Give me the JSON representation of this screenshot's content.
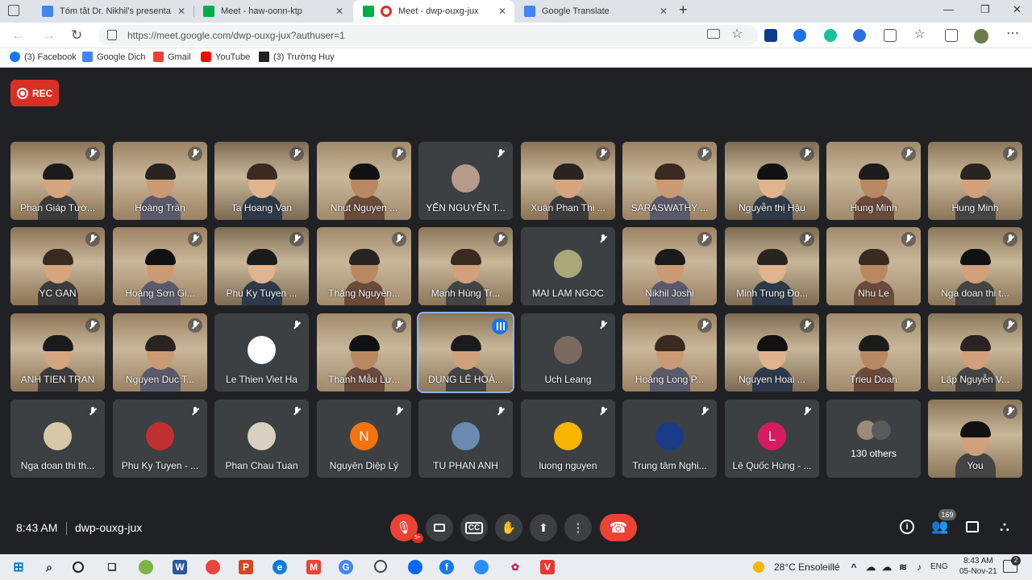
{
  "browser": {
    "tabs": [
      {
        "label": "Tóm tắt Dr. Nikhil's presentation",
        "icon": "google-docs-icon",
        "color": "#4285f4",
        "active": false
      },
      {
        "label": "Meet - haw-oonn-ktp",
        "icon": "google-meet-icon",
        "color": "#00ac47",
        "active": false
      },
      {
        "label": "Meet - dwp-ouxg-jux",
        "icon": "google-meet-icon",
        "color": "#00ac47",
        "active": true
      },
      {
        "label": "Google Translate",
        "icon": "google-translate-icon",
        "color": "#4285f4",
        "active": false
      }
    ],
    "url": "https://meet.google.com/dwp-ouxg-jux?authuser=1",
    "bookmarks": [
      {
        "label": "(3) Facebook",
        "icon": "facebook-icon",
        "color": "#1877f2"
      },
      {
        "label": "Google Dịch",
        "icon": "google-translate-icon",
        "color": "#4285f4"
      },
      {
        "label": "Gmail",
        "icon": "gmail-icon",
        "color": "#ea4335"
      },
      {
        "label": "YouTube",
        "icon": "youtube-icon",
        "color": "#ff0000"
      },
      {
        "label": "(3) Trường Huy",
        "icon": "graduation-cap-icon",
        "color": "#222222"
      }
    ]
  },
  "meet": {
    "rec_label": "REC",
    "time": "8:43 AM",
    "code": "dwp-ouxg-jux",
    "participant_count": "169",
    "reactions_badge": "5+",
    "participants": [
      {
        "name": "Phan Giáp Tườ...",
        "kind": "cam",
        "muted": true
      },
      {
        "name": "Hoàng Trần",
        "kind": "cam",
        "muted": true
      },
      {
        "name": "Ta Hoang Van",
        "kind": "cam",
        "muted": true
      },
      {
        "name": "Nhut Nguyen ...",
        "kind": "cam",
        "muted": true
      },
      {
        "name": "YẾN NGUYỄN T...",
        "kind": "avatar",
        "avatar_color": "#b89a8a",
        "muted": true
      },
      {
        "name": "Xuân Phan Thị ...",
        "kind": "cam",
        "muted": true
      },
      {
        "name": "SARASWATHY ...",
        "kind": "cam",
        "muted": true
      },
      {
        "name": "Nguyễn thị Hậu",
        "kind": "cam",
        "muted": true
      },
      {
        "name": "Hung Minh",
        "kind": "cam",
        "muted": true
      },
      {
        "name": "Hung Minh",
        "kind": "cam",
        "muted": true
      },
      {
        "name": "YC GAN",
        "kind": "cam",
        "muted": true
      },
      {
        "name": "Hoàng Sơn Gi...",
        "kind": "cam",
        "muted": true
      },
      {
        "name": "Phu Ky Tuyen ...",
        "kind": "cam",
        "muted": true
      },
      {
        "name": "Thắng Nguyễn...",
        "kind": "cam",
        "muted": true
      },
      {
        "name": "Mạnh Hùng Tr...",
        "kind": "cam",
        "muted": true
      },
      {
        "name": "MAI LAM NGOC",
        "kind": "avatar",
        "avatar_color": "#a8a878",
        "muted": true
      },
      {
        "name": "Nikhil Joshi",
        "kind": "cam",
        "muted": true
      },
      {
        "name": "Minh Trung Đo...",
        "kind": "cam",
        "muted": true
      },
      {
        "name": "Nhu Le",
        "kind": "cam",
        "muted": true
      },
      {
        "name": "Nga doan thi t...",
        "kind": "cam",
        "muted": true
      },
      {
        "name": "ANH TIEN TRAN",
        "kind": "cam",
        "muted": true
      },
      {
        "name": "Nguyen Duc T...",
        "kind": "cam",
        "muted": true
      },
      {
        "name": "Le Thien Viet Ha",
        "kind": "avatar",
        "avatar_color": "#ffffff",
        "muted": true
      },
      {
        "name": "Thanh Mẫu Lư...",
        "kind": "cam",
        "muted": true
      },
      {
        "name": "DUNG LÊ HOÀ...",
        "kind": "cam",
        "muted": false,
        "speaking": true
      },
      {
        "name": "Uch Leang",
        "kind": "avatar",
        "avatar_color": "#7a6a60",
        "muted": true
      },
      {
        "name": "Hoàng Long P...",
        "kind": "cam",
        "muted": true
      },
      {
        "name": "Nguyen Hoai ...",
        "kind": "cam",
        "muted": true
      },
      {
        "name": "Trieu Doan",
        "kind": "cam",
        "muted": true
      },
      {
        "name": "Lập Nguyễn V...",
        "kind": "cam",
        "muted": true
      },
      {
        "name": "Nga doan thi th...",
        "kind": "avatar",
        "avatar_color": "#d8c8a8",
        "muted": true
      },
      {
        "name": "Phu Ky Tuyen - ...",
        "kind": "avatar",
        "avatar_color": "#c03030",
        "muted": true
      },
      {
        "name": "Phan Chau Tuan",
        "kind": "avatar",
        "avatar_color": "#d8d0c0",
        "muted": true
      },
      {
        "name": "Nguyên Diệp Lý",
        "kind": "avatar",
        "avatar_color": "#f4730d",
        "initial": "N",
        "muted": true
      },
      {
        "name": "TU PHAN ANH",
        "kind": "avatar",
        "avatar_color": "#6a8ab0",
        "muted": true
      },
      {
        "name": "luong nguyen",
        "kind": "avatar",
        "avatar_color": "#f7b500",
        "muted": true
      },
      {
        "name": "Trung tâm Nghi...",
        "kind": "avatar",
        "avatar_color": "#1a3a8a",
        "muted": true
      },
      {
        "name": "Lê Quốc Hùng - ...",
        "kind": "avatar",
        "avatar_color": "#d81b60",
        "initial": "L",
        "muted": true
      },
      {
        "name": "130 others",
        "kind": "others",
        "muted": false
      },
      {
        "name": "You",
        "kind": "cam",
        "muted": true
      }
    ]
  },
  "taskbar": {
    "weather": "28°C  Ensoleillé",
    "lang": "ENG",
    "time": "8:43 AM",
    "date": "05-Nov-21",
    "notif_count": "2"
  }
}
